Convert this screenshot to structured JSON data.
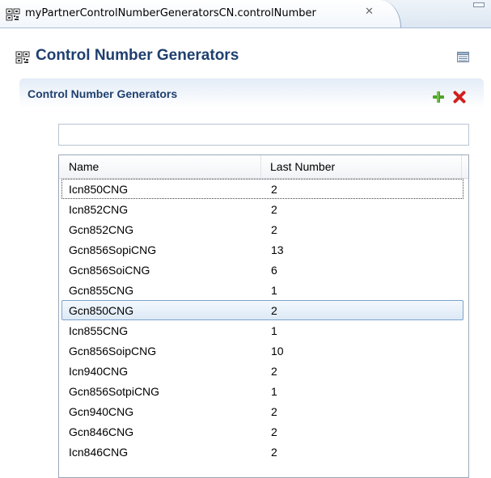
{
  "editor_tab": {
    "title": "myPartnerControlNumberGeneratorsCN.controlNumber",
    "close_glyph": "✕",
    "icon": "grid-icon"
  },
  "form": {
    "title": "Control Number Generators",
    "title_color": "#1f3f6f",
    "menu_icon": "view-menu-icon"
  },
  "section": {
    "title": "Control Number Generators",
    "add_icon": "add-icon",
    "delete_icon": "delete-icon"
  },
  "filter": {
    "value": "",
    "placeholder": ""
  },
  "table": {
    "columns": [
      "Name",
      "Last Number"
    ],
    "rows": [
      {
        "name": "Icn850CNG",
        "last": "2"
      },
      {
        "name": "Icn852CNG",
        "last": "2"
      },
      {
        "name": "Gcn852CNG",
        "last": "2"
      },
      {
        "name": "Gcn856SopiCNG",
        "last": "13"
      },
      {
        "name": "Gcn856SoiCNG",
        "last": "6"
      },
      {
        "name": "Gcn855CNG",
        "last": "1"
      },
      {
        "name": "Gcn850CNG",
        "last": "2"
      },
      {
        "name": "Icn855CNG",
        "last": "1"
      },
      {
        "name": "Gcn856SoipCNG",
        "last": "10"
      },
      {
        "name": "Icn940CNG",
        "last": "2"
      },
      {
        "name": "Gcn856SotpiCNG",
        "last": "1"
      },
      {
        "name": "Gcn940CNG",
        "last": "2"
      },
      {
        "name": "Gcn846CNG",
        "last": "2"
      },
      {
        "name": "Icn846CNG",
        "last": "2"
      }
    ],
    "focused_row": "Icn850CNG",
    "selected_row": "Gcn850CNG",
    "selection_color": "#dde9f6"
  }
}
